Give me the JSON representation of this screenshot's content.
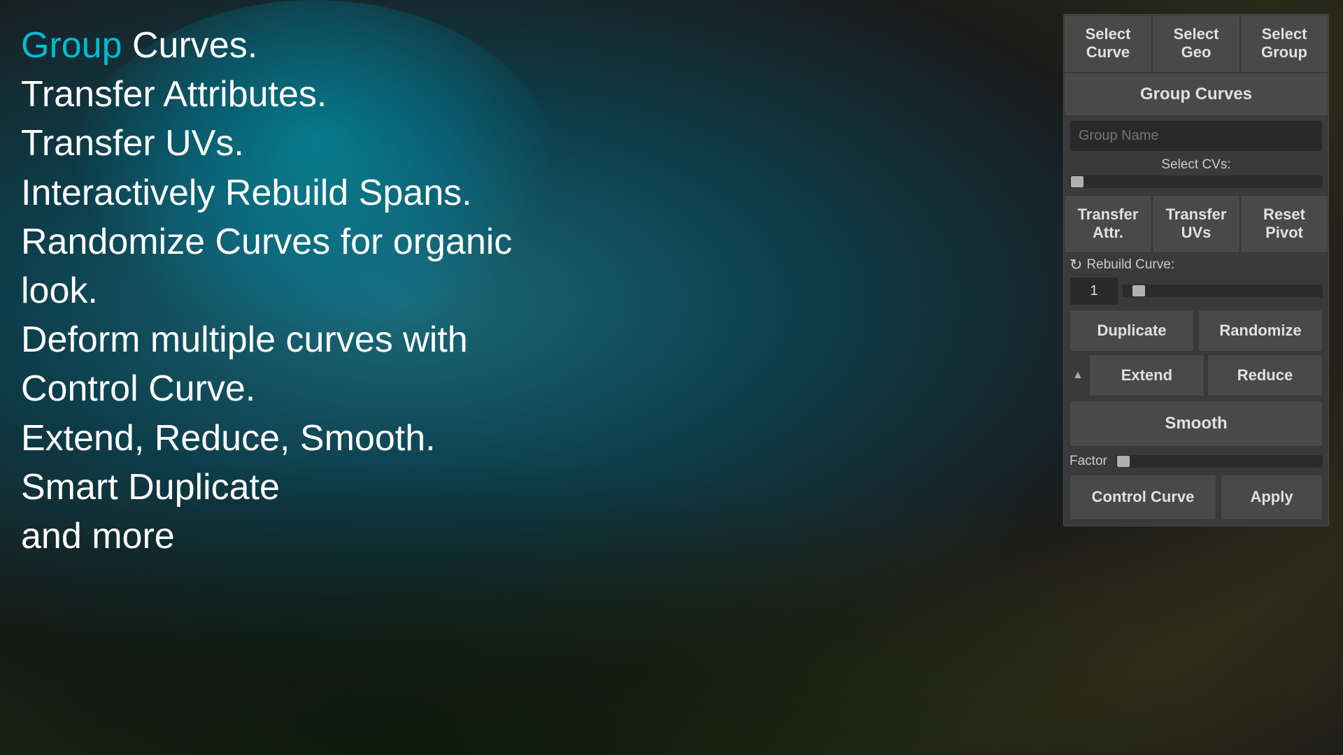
{
  "background": {
    "description": "Dark atmospheric background with teal cloud and dark foliage"
  },
  "overlay": {
    "lines": [
      {
        "text": "Group",
        "highlight": true
      },
      {
        "text": " Curves."
      },
      {
        "text": "Transfer Attributes.",
        "highlight": false
      },
      {
        "text": "Transfer UVs.",
        "highlight": false
      },
      {
        "text": "Interactively Rebuild Spans.",
        "highlight": false
      },
      {
        "text": "Randomize Curves for organic",
        "highlight": false
      },
      {
        "text": "look.",
        "highlight": false
      },
      {
        "text": "Deform multiple curves with",
        "highlight": false
      },
      {
        "text": "Control Curve.",
        "highlight": false
      },
      {
        "text": "Extend, Reduce, Smooth.",
        "highlight": false
      },
      {
        "text": "Smart Duplicate",
        "highlight": false
      },
      {
        "text": "and more",
        "highlight": false
      }
    ]
  },
  "panel": {
    "select_curve_label": "Select\nCurve",
    "select_geo_label": "Select\nGeo",
    "select_group_label": "Select\nGroup",
    "group_curves_label": "Group Curves",
    "group_name_placeholder": "Group Name",
    "select_cvs_label": "Select CVs:",
    "transfer_attr_label": "Transfer\nAttr.",
    "transfer_uvs_label": "Transfer\nUVs",
    "reset_pivot_label": "Reset\nPivot",
    "rebuild_curve_label": "Rebuild Curve:",
    "rebuild_value": "1",
    "duplicate_label": "Duplicate",
    "randomize_label": "Randomize",
    "extend_label": "Extend",
    "reduce_label": "Reduce",
    "smooth_label": "Smooth",
    "factor_label": "Factor",
    "control_curve_label": "Control Curve",
    "apply_label": "Apply"
  }
}
